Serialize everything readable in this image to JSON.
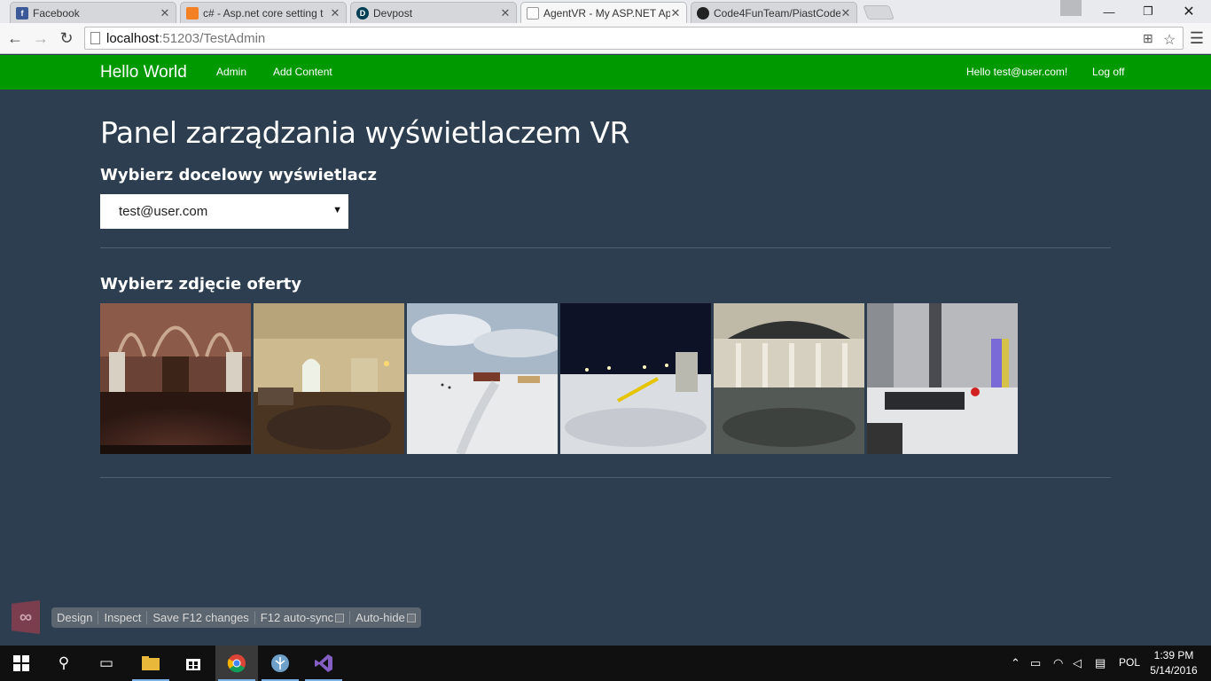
{
  "browser": {
    "tabs": [
      {
        "title": "Facebook",
        "icon": "facebook-icon"
      },
      {
        "title": "c# - Asp.net core setting t",
        "icon": "stackoverflow-icon"
      },
      {
        "title": "Devpost",
        "icon": "devpost-icon"
      },
      {
        "title": "AgentVR - My ASP.NET Ap",
        "icon": "page-icon"
      },
      {
        "title": "Code4FunTeam/PiastCode",
        "icon": "github-icon"
      }
    ],
    "address": {
      "host": "localhost",
      "path": ":51203/TestAdmin"
    }
  },
  "navbar": {
    "brand": "Hello World",
    "links": [
      "Admin",
      "Add Content"
    ],
    "greeting": "Hello test@user.com!",
    "logoff": "Log off",
    "color": "#009900"
  },
  "main": {
    "title": "Panel zarządzania wyświetlaczem VR",
    "display_heading": "Wybierz docelowy wyświetlacz",
    "display_selected": "test@user.com",
    "offer_heading": "Wybierz zdjęcie oferty",
    "photos": [
      "church-interior-panorama",
      "living-room-panorama",
      "ski-slope-day-panorama",
      "ski-slope-night-panorama",
      "palace-hall-panorama",
      "atrium-event-panorama"
    ]
  },
  "browserlink": {
    "items": [
      "Design",
      "Inspect",
      "Save F12 changes",
      "F12 auto-sync",
      "Auto-hide"
    ]
  },
  "taskbar": {
    "language": "POL",
    "time": "1:39 PM",
    "date": "5/14/2016"
  }
}
